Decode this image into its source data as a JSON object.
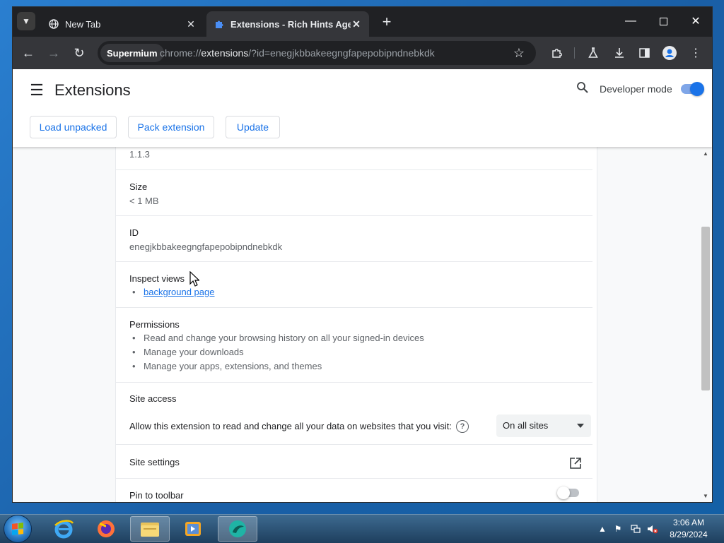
{
  "browser": {
    "tabs": [
      {
        "title": "New Tab",
        "active": false,
        "favicon": "globe-icon"
      },
      {
        "title": "Extensions - Rich Hints Agent",
        "active": true,
        "favicon": "puzzle-icon"
      }
    ],
    "site_chip": "Supermium",
    "url_scheme": "chrome://",
    "url_host": "extensions",
    "url_path": "/?id=enegjkbbakeegngfapepobipndnebkdk"
  },
  "extensions_page": {
    "title": "Extensions",
    "developer_mode_label": "Developer mode",
    "developer_mode_on": true,
    "buttons": {
      "load_unpacked": "Load unpacked",
      "pack_extension": "Pack extension",
      "update": "Update"
    }
  },
  "details": {
    "version_value": "1.1.3",
    "size_label": "Size",
    "size_value": "< 1 MB",
    "id_label": "ID",
    "id_value": "enegjkbbakeegngfapepobipndnebkdk",
    "inspect_views_label": "Inspect views",
    "inspect_views": [
      "background page"
    ],
    "permissions_label": "Permissions",
    "permissions": [
      "Read and change your browsing history on all your signed-in devices",
      "Manage your downloads",
      "Manage your apps, extensions, and themes"
    ],
    "site_access_label": "Site access",
    "site_access_text": "Allow this extension to read and change all your data on websites that you visit:",
    "site_access_value": "On all sites",
    "site_settings_label": "Site settings",
    "pin_to_toolbar_label": "Pin to toolbar",
    "pin_to_toolbar_on": false
  },
  "taskbar": {
    "time": "3:06 AM",
    "date": "8/29/2024",
    "items": [
      "internet-explorer-icon",
      "firefox-icon",
      "file-explorer-icon",
      "media-player-icon",
      "supermium-icon"
    ]
  },
  "colors": {
    "accent": "#1a73e8",
    "titlebar": "#202124",
    "toolbar": "#35363a"
  }
}
